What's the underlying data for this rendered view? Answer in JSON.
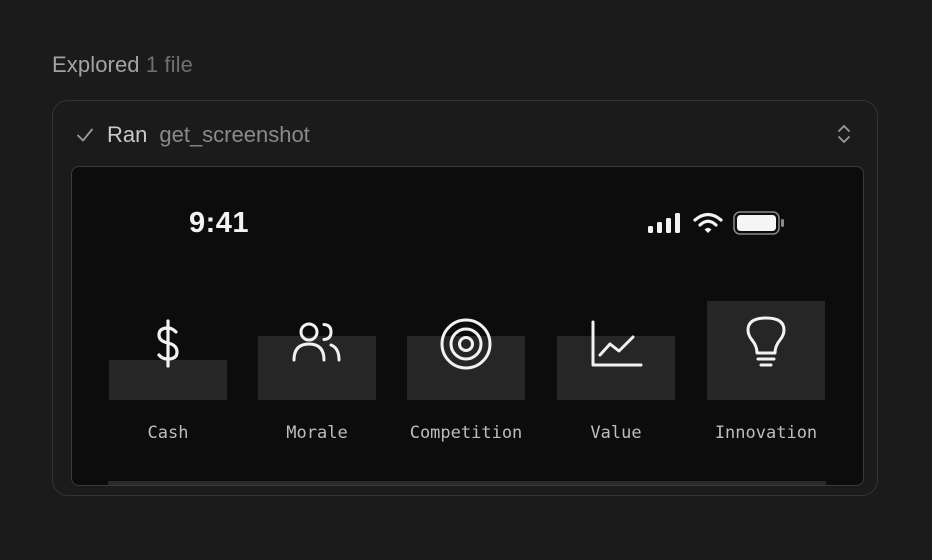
{
  "explored": {
    "label": "Explored",
    "count": "1 file"
  },
  "tool_call": {
    "status": "Ran",
    "tool_name": "get_screenshot"
  },
  "phone": {
    "time": "9:41",
    "stats": [
      {
        "label": "Cash",
        "icon": "dollar-icon",
        "fill": 0.34
      },
      {
        "label": "Morale",
        "icon": "users-icon",
        "fill": 0.54
      },
      {
        "label": "Competition",
        "icon": "target-icon",
        "fill": 0.54
      },
      {
        "label": "Value",
        "icon": "line-chart-icon",
        "fill": 0.54
      },
      {
        "label": "Innovation",
        "icon": "lightbulb-icon",
        "fill": 0.84
      }
    ]
  }
}
